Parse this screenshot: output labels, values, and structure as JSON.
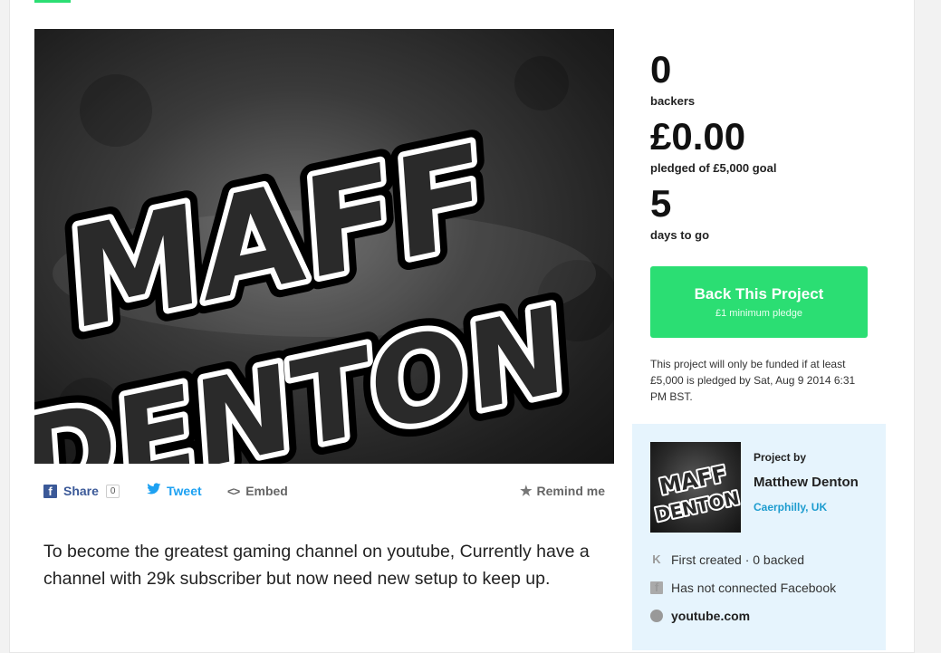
{
  "hero": {
    "logo_line1": "MAFF",
    "logo_line2": "DENTON"
  },
  "share_bar": {
    "facebook_label": "Share",
    "facebook_count": "0",
    "tweet_label": "Tweet",
    "embed_label": "Embed",
    "remind_label": "Remind me"
  },
  "description": "To become the greatest gaming channel on youtube, Currently have a channel with 29k subscriber but now need new setup to keep up.",
  "stats": {
    "backers_value": "0",
    "backers_label": "backers",
    "pledged_value": "£0.00",
    "pledged_label": "pledged of £5,000 goal",
    "days_value": "5",
    "days_label": "days to go"
  },
  "back_button": {
    "label": "Back This Project",
    "sublabel": "£1 minimum pledge"
  },
  "funding_note": "This project will only be funded if at least £5,000 is pledged by Sat, Aug 9 2014 6:31 PM BST.",
  "creator": {
    "project_by": "Project by",
    "name": "Matthew Denton",
    "location": "Caerphilly, UK",
    "created_text": "First created · 0 backed",
    "facebook_text": "Has not connected Facebook",
    "website": "youtube.com"
  },
  "icons": {
    "facebook": "facebook-icon",
    "twitter": "twitter-bird-icon",
    "embed": "code-brackets-icon",
    "remind": "star-icon",
    "kickstarter": "kickstarter-k-icon",
    "globe": "globe-icon"
  },
  "colors": {
    "accent_green": "#2bde73",
    "facebook_blue": "#3b5998",
    "twitter_blue": "#1da1f2",
    "link_blue": "#1d9ccf",
    "creator_panel_bg": "#e6f4fd"
  }
}
